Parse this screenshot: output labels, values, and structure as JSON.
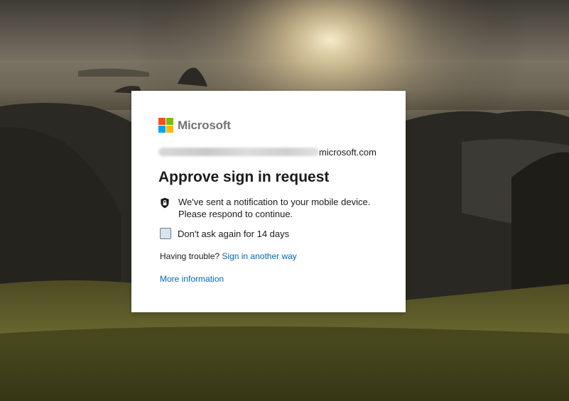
{
  "background": {
    "description_colors": {
      "sky_top": "#4a4540",
      "sun_glow": "#f3e7c2",
      "hills": "#2d2a22",
      "grass": "#5c5a2a"
    }
  },
  "brand": {
    "name": "Microsoft",
    "logo_colors": [
      "#f25022",
      "#7fba00",
      "#00a4ef",
      "#ffb900"
    ]
  },
  "account": {
    "domain_suffix": "microsoft.com"
  },
  "dialog": {
    "title": "Approve sign in request",
    "notification_text": "We've sent a notification to your mobile device. Please respond to continue.",
    "checkbox_label": "Don't ask again for 14 days",
    "checkbox_checked": false,
    "trouble_prefix": "Having trouble?",
    "trouble_link": "Sign in another way",
    "more_info_link": "More information"
  },
  "colors": {
    "link": "#0067b8",
    "text": "#1b1b1b",
    "card_bg": "#ffffff"
  }
}
